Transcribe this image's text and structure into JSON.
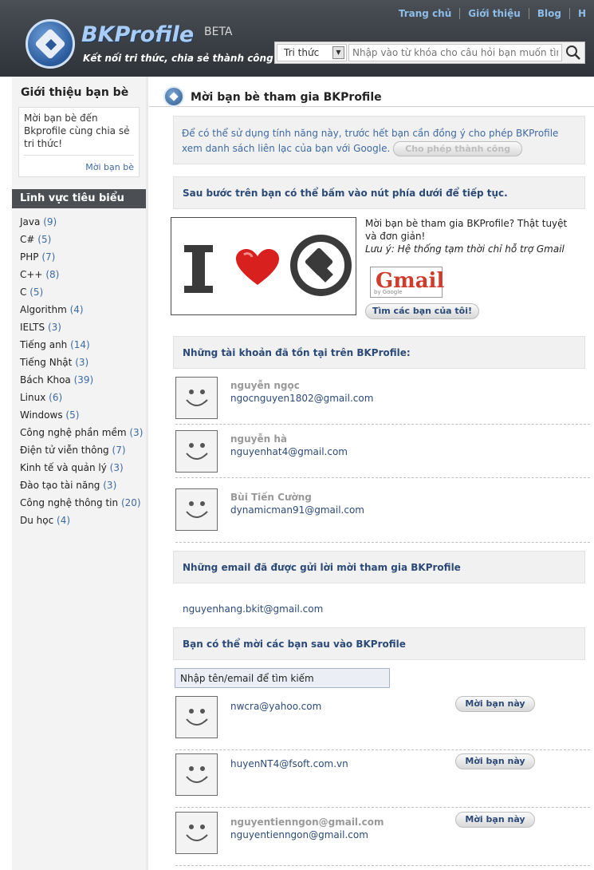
{
  "header": {
    "logo_text": "BKProfile",
    "beta": "BETA",
    "slogan": "Kết nối tri thức, chia sẻ thành công",
    "nav": [
      "Trang chủ",
      "Giới thiệu",
      "Blog",
      "H"
    ],
    "search": {
      "category": "Tri thức",
      "placeholder": "Nhập vào từ khóa cho câu hỏi bạn muốn tìm"
    }
  },
  "sidebar": {
    "title": "Giới thiệu bạn bè",
    "invite_text": "Mời bạn bè đến Bkprofile cùng chia sẻ tri thức!",
    "invite_link": "Mời bạn bè",
    "categories_title": "Lĩnh vực tiêu biểu",
    "categories": [
      {
        "name": "Java",
        "count": "(9)"
      },
      {
        "name": "C#",
        "count": "(5)"
      },
      {
        "name": "PHP",
        "count": "(7)"
      },
      {
        "name": "C++",
        "count": "(8)"
      },
      {
        "name": "C",
        "count": "(5)"
      },
      {
        "name": "Algorithm",
        "count": "(4)"
      },
      {
        "name": "IELTS",
        "count": "(3)"
      },
      {
        "name": "Tiếng anh",
        "count": "(14)"
      },
      {
        "name": "Tiếng Nhật",
        "count": "(3)"
      },
      {
        "name": "Bách Khoa",
        "count": "(39)"
      },
      {
        "name": "Linux",
        "count": "(6)"
      },
      {
        "name": "Windows",
        "count": "(5)"
      },
      {
        "name": "Công nghệ phần mềm",
        "count": "(3)"
      },
      {
        "name": "Điện tử viễn thông",
        "count": "(7)"
      },
      {
        "name": "Kinh tế và quản lý",
        "count": "(3)"
      },
      {
        "name": "Đào tạo tài năng",
        "count": "(3)"
      },
      {
        "name": "Công nghệ thông tin",
        "count": "(20)"
      },
      {
        "name": "Du học",
        "count": "(4)"
      }
    ]
  },
  "main": {
    "title": "Mời bạn bè tham gia BKProfile",
    "notice": "Để có thể sử dụng tính năng này, trước hết bạn cần đồng ý cho phép BKProfile xem danh sách liên lạc của bạn với Google.",
    "allow_button": "Cho phép thành công",
    "continue_text": "Sau bước trên bạn có thể bấm vào nút phía dưới để tiếp tục.",
    "promo_text": "Mời bạn bè tham gia BKProfile? Thật tuyệt và đơn giản!",
    "promo_note": "Lưu ý: Hệ thống tạm thời chỉ hỗ trợ Gmail",
    "gmail_logo": "Gmail",
    "gmail_by": "by Google",
    "find_button": "Tìm các bạn của tôi!",
    "existing_title": "Những tài khoản đã tồn tại trên BKProfile:",
    "existing_users": [
      {
        "name": "nguyễn ngọc",
        "email": "ngocnguyen1802@gmail.com"
      },
      {
        "name": "nguyễn hà",
        "email": "nguyenhat4@gmail.com"
      },
      {
        "name": "Bùi Tiến Cường",
        "email": "dynamicman91@gmail.com"
      }
    ],
    "sent_title": "Những email đã được gửi lời mời tham gia BKProfile",
    "sent_emails": [
      "nguyenhang.bkit@gmail.com"
    ],
    "invite_title": "Bạn có thể mời các bạn sau vào BKProfile",
    "filter_value": "Nhập tên/email để tìm kiếm",
    "invite_button": "Mời bạn này",
    "suggestions": [
      {
        "name": "",
        "email": "nwcra@yahoo.com"
      },
      {
        "name": "",
        "email": "huyenNT4@fsoft.com.vn"
      },
      {
        "name": "nguyentienngon@gmail.com",
        "email": "nguyentienngon@gmail.com"
      }
    ]
  }
}
